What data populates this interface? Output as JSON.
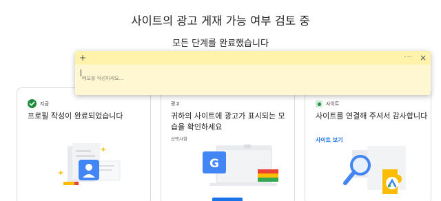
{
  "header": {
    "title": "사이트의 광고 게재 가능 여부 검토 중",
    "subtitle": "모든 단계를 완료했습니다"
  },
  "cards": [
    {
      "status": "지금",
      "title": "프로필 작성이 완료되었습니다"
    },
    {
      "status": "광고",
      "title": "귀하의 사이트에 광고가 표시되는 모습을 확인하세요",
      "note": "선택사항"
    },
    {
      "status": "사이트",
      "title": "사이트를 연결해 주셔서 감사합니다",
      "link": "사이트 보기"
    }
  ],
  "sticky_note": {
    "add_symbol": "+",
    "more_symbol": "···",
    "close_symbol": "×",
    "placeholder": "메모를 작성하세요..."
  },
  "illustration_letter": "G",
  "colors": {
    "accent_blue": "#1a73e8",
    "success_green": "#1e8e3e",
    "note_body": "#fff7d1",
    "note_header": "#fff2ab"
  },
  "icons": [
    "check-circle-icon",
    "site-dot-icon",
    "profile-illustration",
    "ad-preview-illustration",
    "site-puzzle-illustration"
  ]
}
